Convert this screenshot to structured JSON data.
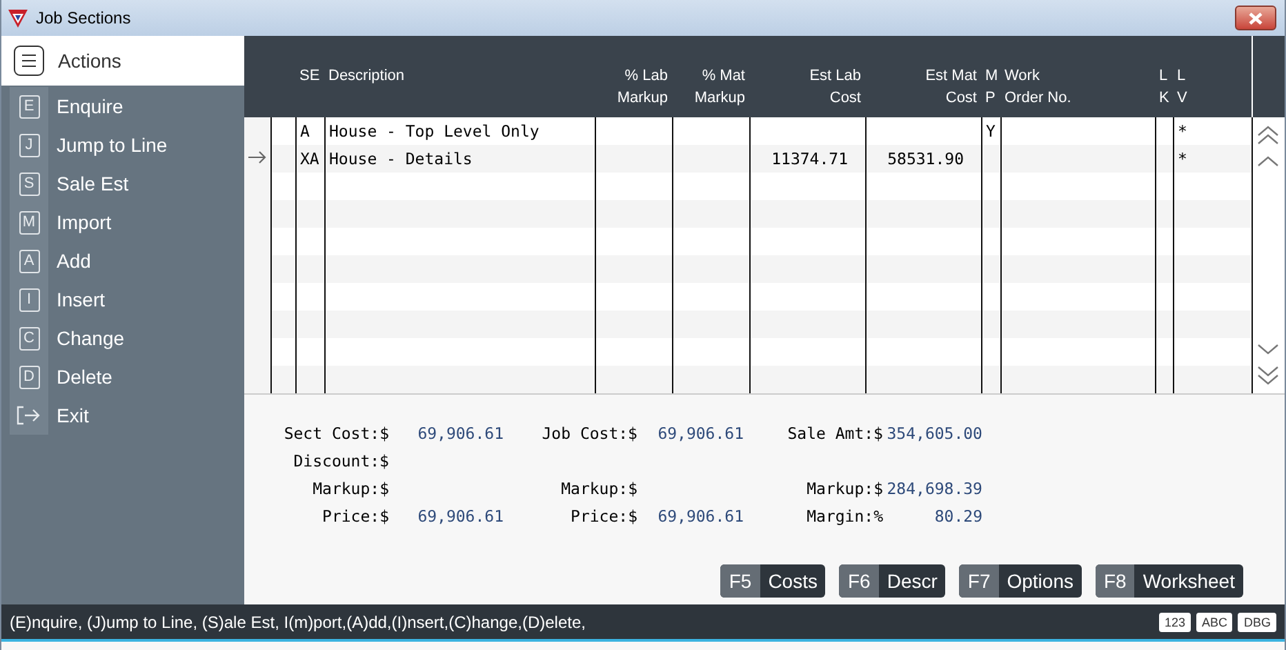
{
  "window": {
    "title": "Job Sections"
  },
  "sidebar": {
    "title": "Actions",
    "items": [
      {
        "kind": "key",
        "key": "E",
        "label": "Enquire"
      },
      {
        "kind": "key",
        "key": "J",
        "label": "Jump to Line"
      },
      {
        "kind": "key",
        "key": "S",
        "label": "Sale Est"
      },
      {
        "kind": "key",
        "key": "M",
        "label": "Import"
      },
      {
        "kind": "key",
        "key": "A",
        "label": "Add"
      },
      {
        "kind": "key",
        "key": "I",
        "label": "Insert"
      },
      {
        "kind": "key",
        "key": "C",
        "label": "Change"
      },
      {
        "kind": "key",
        "key": "D",
        "label": "Delete"
      },
      {
        "kind": "exit",
        "label": "Exit"
      }
    ]
  },
  "table": {
    "columns": [
      {
        "lines": [
          "SE"
        ],
        "numeric": false
      },
      {
        "lines": [
          "Description"
        ],
        "numeric": false
      },
      {
        "lines": [
          "% Lab",
          "Markup"
        ],
        "numeric": true
      },
      {
        "lines": [
          "% Mat",
          "Markup"
        ],
        "numeric": true
      },
      {
        "lines": [
          "Est Lab",
          "Cost"
        ],
        "numeric": true
      },
      {
        "lines": [
          "Est Mat",
          "Cost"
        ],
        "numeric": true
      },
      {
        "lines": [
          "M",
          "P"
        ],
        "numeric": false
      },
      {
        "lines": [
          "Work",
          "Order No."
        ],
        "numeric": false
      },
      {
        "lines": [
          "L",
          "K"
        ],
        "numeric": false
      },
      {
        "lines": [
          "L",
          "V"
        ],
        "numeric": false
      }
    ],
    "rows": [
      {
        "current": false,
        "cells": [
          "A",
          "House - Top Level Only",
          "",
          "",
          "",
          "",
          "Y",
          "",
          "",
          "*"
        ]
      },
      {
        "current": true,
        "cells": [
          "XA",
          "House - Details",
          "",
          "",
          "11374.71",
          "58531.90",
          "",
          "",
          "",
          "*"
        ]
      }
    ]
  },
  "summary": [
    [
      {
        "label": "Sect Cost:$",
        "value": "69,906.61"
      },
      {
        "label": "Job Cost:$",
        "value": "69,906.61"
      },
      {
        "label": "Sale Amt:$",
        "value": "354,605.00"
      }
    ],
    [
      {
        "label": "Discount:$"
      }
    ],
    [
      {
        "label": "Markup:$"
      },
      {
        "label": "Markup:$"
      },
      {
        "label": "Markup:$",
        "value": "284,698.39"
      }
    ],
    [
      {
        "label": "Price:$",
        "value": "69,906.61"
      },
      {
        "label": "Price:$",
        "value": "69,906.61"
      },
      {
        "label": "Margin:%",
        "value": "80.29"
      }
    ]
  ],
  "function_keys": [
    {
      "key": "F5",
      "label": "Costs"
    },
    {
      "key": "F6",
      "label": "Descr"
    },
    {
      "key": "F7",
      "label": "Options"
    },
    {
      "key": "F8",
      "label": "Worksheet"
    }
  ],
  "status_bar": {
    "text": "(E)nquire, (J)ump to Line, (S)ale Est, I(m)port,(A)dd,(I)nsert,(C)hange,(D)elete,",
    "badges": [
      "123",
      "ABC",
      "DBG"
    ]
  }
}
